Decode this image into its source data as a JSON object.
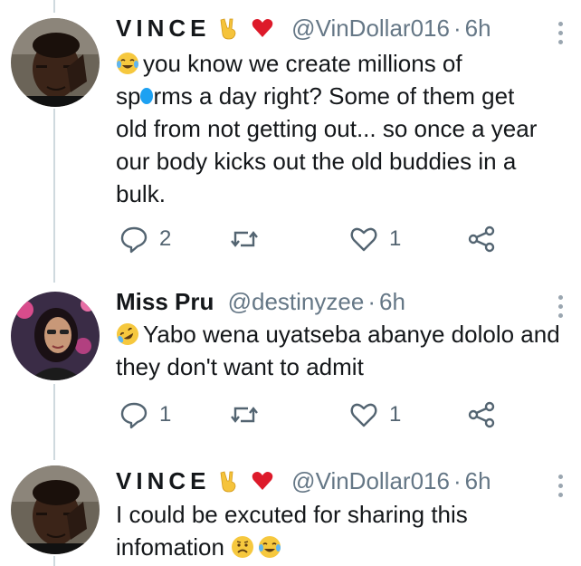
{
  "tweets": [
    {
      "author": {
        "name": "VINCE",
        "handle": "@VinDollar016",
        "time": "6h"
      },
      "name_emojis": [
        "victory-hand",
        "red-heart"
      ],
      "text_emoji": "tears-of-joy",
      "text": "you know we create millions  of sp⬤rms a day right?  Some of them get old from not getting  out... so once a year our body kicks  out the  old buddies in a bulk.",
      "text_parts": {
        "line1": "you know we create millions  of",
        "line2a": "sp",
        "line2b": "rms a day right?  Some of them get",
        "rest": "old from not getting  out... so once a year our body kicks  out the  old buddies in a bulk."
      },
      "actions": {
        "replies": "2",
        "retweets": "",
        "likes": "1"
      }
    },
    {
      "author": {
        "name": "Miss Pru",
        "handle": "@destinyzee",
        "time": "6h"
      },
      "text_emoji": "rolling-on-floor-laughing",
      "text": "Yabo wena uyatseba abanye dololo and they don't want to admit",
      "actions": {
        "replies": "1",
        "retweets": "",
        "likes": "1"
      }
    },
    {
      "author": {
        "name": "VINCE",
        "handle": "@VinDollar016",
        "time": "6h"
      },
      "name_emojis": [
        "victory-hand",
        "red-heart"
      ],
      "text": "I could be excuted  for sharing this infomation",
      "trailing_emojis": [
        "worried-face",
        "tears-of-joy"
      ]
    }
  ],
  "colors": {
    "text": "#14171a",
    "secondary": "#657786",
    "thread": "#cfd9de",
    "heart": "#e0245e",
    "censor": "#1da1f2"
  }
}
